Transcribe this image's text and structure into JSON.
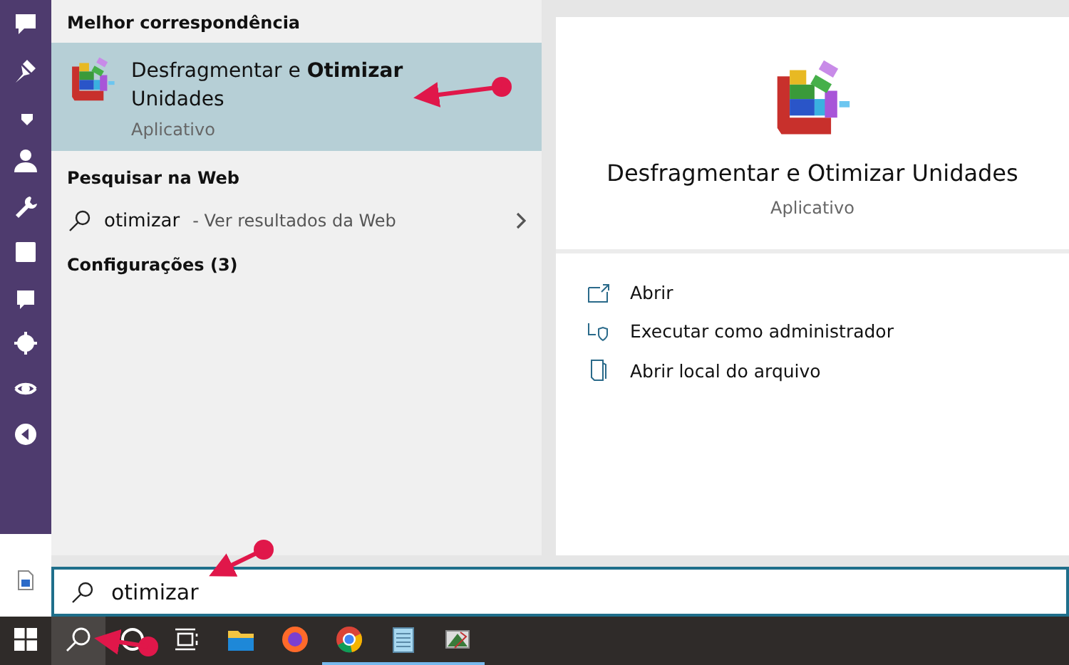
{
  "best_match": {
    "heading": "Melhor correspondência",
    "item": {
      "title": "Desfragmentar e **Otimizar** Unidades",
      "subtitle": "Aplicativo",
      "selected": true
    }
  },
  "web": {
    "heading": "Pesquisar na Web",
    "query": "otimizar",
    "suffix": "- Ver resultados da Web"
  },
  "settings": {
    "heading": "Configurações (3)"
  },
  "details": {
    "title": "Desfragmentar e Otimizar Unidades",
    "subtitle": "Aplicativo",
    "actions": [
      {
        "kind": "open",
        "label": "Abrir"
      },
      {
        "kind": "admin",
        "label": "Executar como administrador"
      },
      {
        "kind": "folder",
        "label": "Abrir local do arquivo"
      }
    ]
  },
  "search": {
    "value": "otimizar"
  },
  "taskbar": {
    "items": [
      {
        "kind": "start",
        "running": false
      },
      {
        "kind": "search",
        "running": false
      },
      {
        "kind": "cortana",
        "running": false
      },
      {
        "kind": "taskview",
        "running": false
      },
      {
        "kind": "explorer",
        "running": false
      },
      {
        "kind": "firefox",
        "running": false
      },
      {
        "kind": "chrome",
        "running": true
      },
      {
        "kind": "notepad",
        "running": true
      },
      {
        "kind": "photos",
        "running": true
      }
    ]
  }
}
